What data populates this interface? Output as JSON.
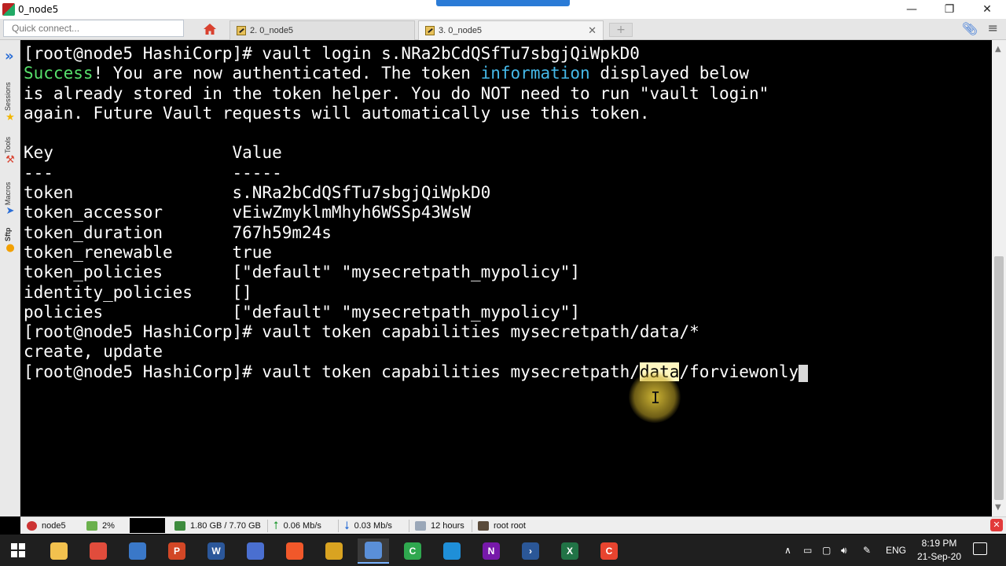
{
  "window": {
    "title": "0_node5",
    "minimize_glyph": "—",
    "maximize_glyph": "❐",
    "close_glyph": "✕"
  },
  "tabbar": {
    "quick_connect_placeholder": "Quick connect...",
    "tabs": [
      {
        "label": "2. 0_node5"
      },
      {
        "label": "3. 0_node5",
        "close_glyph": "✕"
      }
    ],
    "new_tab_glyph": "+"
  },
  "sidebar": {
    "labels": [
      "Sessions",
      "Tools",
      "Macros",
      "Sftp"
    ]
  },
  "terminal": {
    "lines": [
      {
        "parts": [
          {
            "t": "[root@node5 HashiCorp]# vault login s.NRa2bCdQSfTu7sbgjQiWpkD0"
          }
        ]
      },
      {
        "parts": [
          {
            "t": "Success",
            "c": "green"
          },
          {
            "t": "! You are now authenticated. The token "
          },
          {
            "t": "information",
            "c": "cyan"
          },
          {
            "t": " displayed below"
          }
        ]
      },
      {
        "parts": [
          {
            "t": "is already stored in the token helper. You do NOT need to run \"vault login\""
          }
        ]
      },
      {
        "parts": [
          {
            "t": "again. Future Vault requests will automatically use this token."
          }
        ]
      },
      {
        "parts": [
          {
            "t": ""
          }
        ]
      },
      {
        "parts": [
          {
            "t": "Key                  Value"
          }
        ]
      },
      {
        "parts": [
          {
            "t": "---                  -----"
          }
        ]
      },
      {
        "parts": [
          {
            "t": "token                s.NRa2bCdQSfTu7sbgjQiWpkD0"
          }
        ]
      },
      {
        "parts": [
          {
            "t": "token_accessor       vEiwZmyklmMhyh6WSSp43WsW"
          }
        ]
      },
      {
        "parts": [
          {
            "t": "token_duration       767h59m24s"
          }
        ]
      },
      {
        "parts": [
          {
            "t": "token_renewable      true"
          }
        ]
      },
      {
        "parts": [
          {
            "t": "token_policies       [\"default\" \"mysecretpath_mypolicy\"]"
          }
        ]
      },
      {
        "parts": [
          {
            "t": "identity_policies    []"
          }
        ]
      },
      {
        "parts": [
          {
            "t": "policies             [\"default\" \"mysecretpath_mypolicy\"]"
          }
        ]
      },
      {
        "parts": [
          {
            "t": "[root@node5 HashiCorp]# vault token capabilities mysecretpath/data/*"
          }
        ]
      },
      {
        "parts": [
          {
            "t": "create, update"
          }
        ]
      },
      {
        "parts": [
          {
            "t": "[root@node5 HashiCorp]# vault token capabilities mysecretpath/"
          },
          {
            "t": "data",
            "c": "sel"
          },
          {
            "t": "/forviewonly"
          },
          {
            "t": " ",
            "c": "cursor"
          }
        ]
      }
    ],
    "ibeam_glyph": "I"
  },
  "statusbar": {
    "session": "node5",
    "cpu": "2%",
    "memory": "1.80 GB / 7.70 GB",
    "upload": "0.06 Mb/s",
    "download": "0.03 Mb/s",
    "uptime": "12 hours",
    "user": "root  root",
    "close_glyph": "✕"
  },
  "taskbar": {
    "apps": [
      {
        "icon": "folder-icon",
        "glyph": "",
        "color": "#f2c14e"
      },
      {
        "icon": "chrome-icon",
        "glyph": "",
        "color": "#e14c3c"
      },
      {
        "icon": "calculator-icon",
        "glyph": "",
        "color": "#3a78c8"
      },
      {
        "icon": "powerpoint-icon",
        "glyph": "P",
        "color": "#d24726"
      },
      {
        "icon": "word-icon",
        "glyph": "W",
        "color": "#2b579a"
      },
      {
        "icon": "network-icon",
        "glyph": "",
        "color": "#4a6fd0"
      },
      {
        "icon": "brave-icon",
        "glyph": "",
        "color": "#f1582a"
      },
      {
        "icon": "vpn-icon",
        "glyph": "",
        "color": "#d9a321"
      },
      {
        "icon": "mobaxterm-icon",
        "glyph": "",
        "color": "#5a8fd8",
        "active": true
      },
      {
        "icon": "camtasia-icon",
        "glyph": "C",
        "color": "#2fa84f"
      },
      {
        "icon": "edge-icon",
        "glyph": "",
        "color": "#1f8fd8"
      },
      {
        "icon": "onenote-icon",
        "glyph": "N",
        "color": "#7719aa"
      },
      {
        "icon": "powershell-icon",
        "glyph": "›",
        "color": "#2b5797"
      },
      {
        "icon": "excel-icon",
        "glyph": "X",
        "color": "#217346"
      },
      {
        "icon": "camtasia-recorder-icon",
        "glyph": "C",
        "color": "#e8442f"
      }
    ],
    "language": "ENG",
    "time": "8:19 PM",
    "date": "21-Sep-20"
  }
}
